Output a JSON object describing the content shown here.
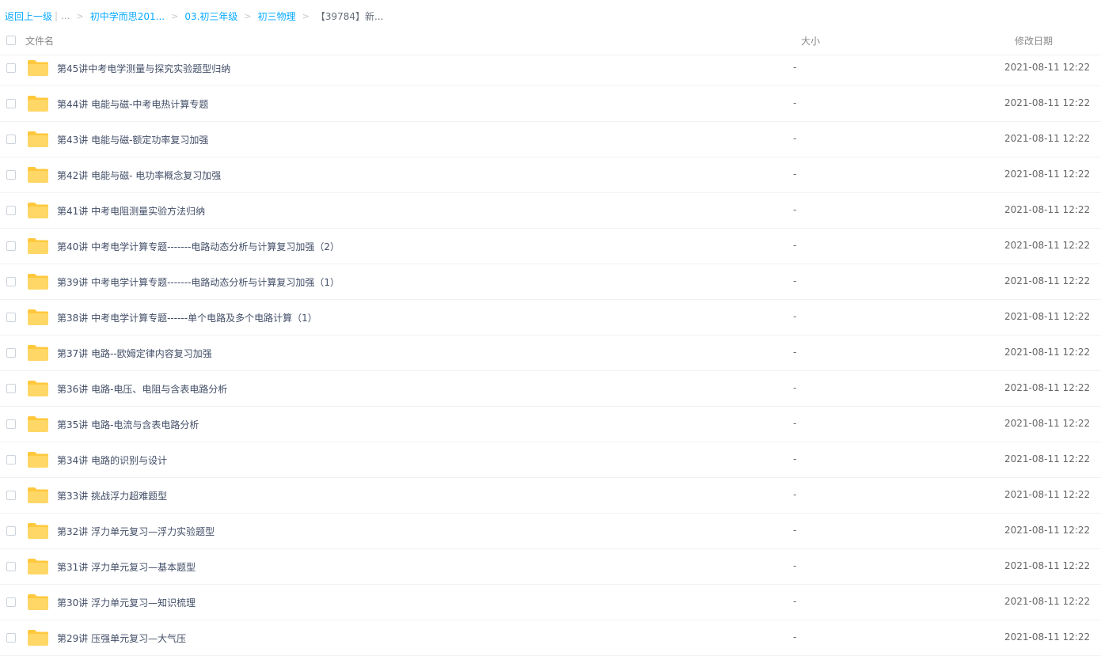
{
  "breadcrumb": {
    "back_label": "返回上一级",
    "separator": "|",
    "ellipsis": "...",
    "items": [
      "初中学而思201...",
      "03.初三年级",
      "初三物理"
    ],
    "current": "【39784】新..."
  },
  "table": {
    "headers": {
      "name": "文件名",
      "size": "大小",
      "date": "修改日期"
    },
    "rows": [
      {
        "name": "第45讲中考电学测量与探究实验题型归纳",
        "size": "-",
        "date": "2021-08-11 12:22"
      },
      {
        "name": "第44讲 电能与磁-中考电热计算专题",
        "size": "-",
        "date": "2021-08-11 12:22"
      },
      {
        "name": "第43讲 电能与磁-额定功率复习加强",
        "size": "-",
        "date": "2021-08-11 12:22"
      },
      {
        "name": "第42讲 电能与磁- 电功率概念复习加强",
        "size": "-",
        "date": "2021-08-11 12:22"
      },
      {
        "name": "第41讲 中考电阻测量实验方法归纳",
        "size": "-",
        "date": "2021-08-11 12:22"
      },
      {
        "name": "第40讲 中考电学计算专题-------电路动态分析与计算复习加强（2）",
        "size": "-",
        "date": "2021-08-11 12:22"
      },
      {
        "name": "第39讲 中考电学计算专题-------电路动态分析与计算复习加强（1）",
        "size": "-",
        "date": "2021-08-11 12:22"
      },
      {
        "name": "第38讲 中考电学计算专题------单个电路及多个电路计算（1）",
        "size": "-",
        "date": "2021-08-11 12:22"
      },
      {
        "name": "第37讲 电路--欧姆定律内容复习加强",
        "size": "-",
        "date": "2021-08-11 12:22"
      },
      {
        "name": "第36讲 电路-电压、电阻与含表电路分析",
        "size": "-",
        "date": "2021-08-11 12:22"
      },
      {
        "name": "第35讲 电路-电流与含表电路分析",
        "size": "-",
        "date": "2021-08-11 12:22"
      },
      {
        "name": "第34讲 电路的识别与设计",
        "size": "-",
        "date": "2021-08-11 12:22"
      },
      {
        "name": "第33讲 挑战浮力超难题型",
        "size": "-",
        "date": "2021-08-11 12:22"
      },
      {
        "name": "第32讲 浮力单元复习—浮力实验题型",
        "size": "-",
        "date": "2021-08-11 12:22"
      },
      {
        "name": "第31讲 浮力单元复习—基本题型",
        "size": "-",
        "date": "2021-08-11 12:22"
      },
      {
        "name": "第30讲 浮力单元复习—知识梳理",
        "size": "-",
        "date": "2021-08-11 12:22"
      },
      {
        "name": "第29讲 压强单元复习—大气压",
        "size": "-",
        "date": "2021-08-11 12:22"
      }
    ]
  },
  "icons": {
    "folder": "folder-icon",
    "folder_color": "#ffd766",
    "folder_tab_color": "#ffc83d"
  },
  "colors": {
    "link": "#09aaff",
    "text": "#424e67",
    "divider": "#f1f2f4"
  }
}
